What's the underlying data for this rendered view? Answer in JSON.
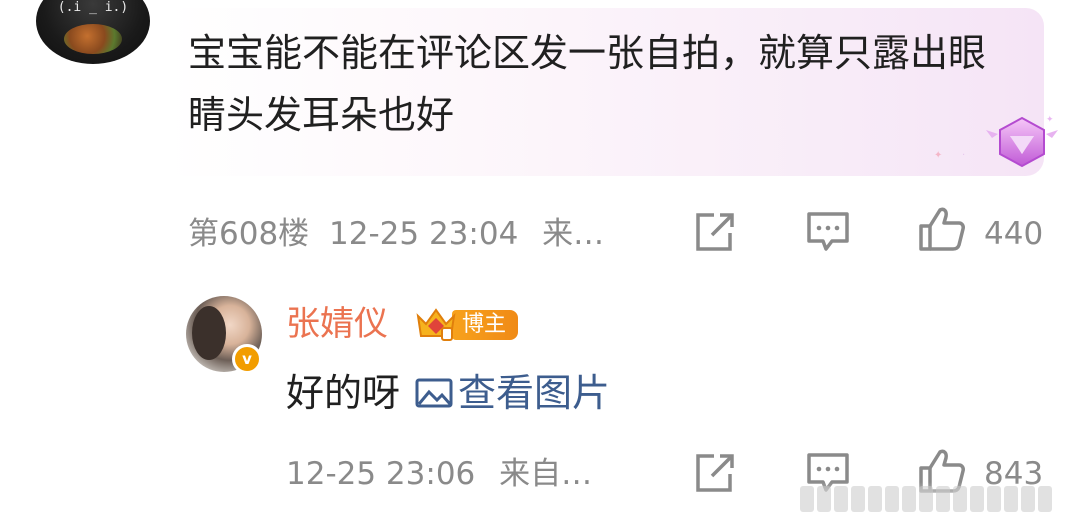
{
  "comment": {
    "avatar_text": "(.i _ i.)",
    "text": "宝宝能不能在评论区发一张自拍，就算只露出眼睛头发耳朵也好",
    "floor": "第608楼",
    "time": "12-25 23:04",
    "source": "来…",
    "likes": "440"
  },
  "reply": {
    "author": "张婧仪",
    "verified_mark": "v",
    "badge_label": "博主",
    "text": "好的呀",
    "image_link": "查看图片",
    "time": "12-25 23:06",
    "source": "来自…",
    "likes": "843"
  },
  "colors": {
    "name": "#eb7350",
    "link": "#3d5d8e",
    "meta": "#8a8a8a",
    "badge": "#f29d00"
  },
  "icons": [
    "repost-icon",
    "comment-icon",
    "like-icon",
    "image-icon",
    "gem-badge-icon",
    "crown-icon"
  ]
}
